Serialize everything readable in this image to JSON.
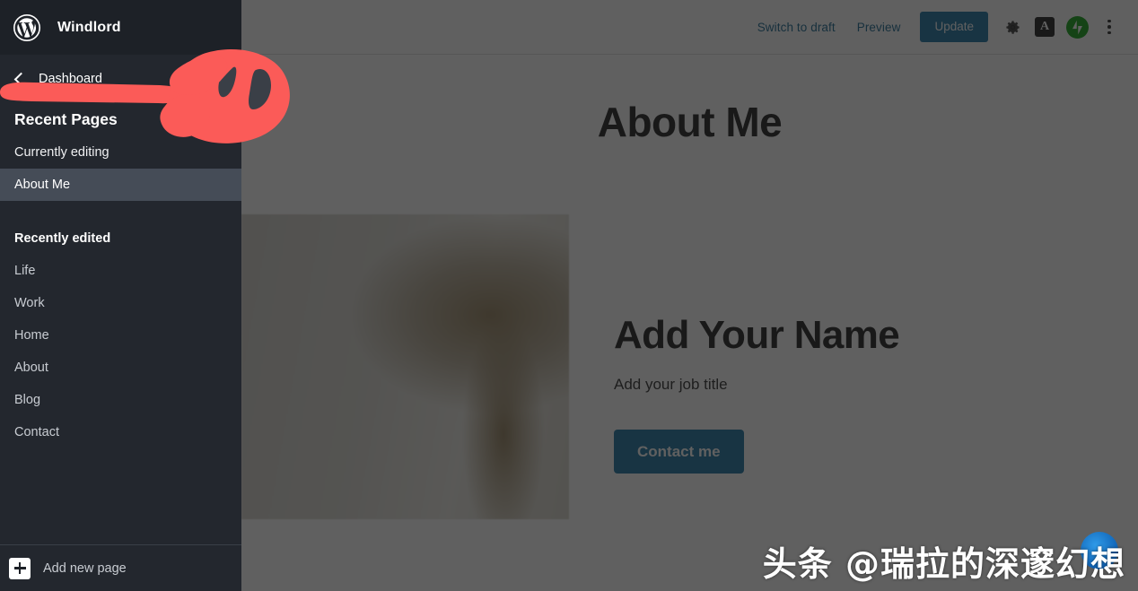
{
  "window": {
    "site_name": "Windlord"
  },
  "toolbar": {
    "list_view_icon": "list-view-icon",
    "switch_to_draft": "Switch to draft",
    "preview": "Preview",
    "update": "Update",
    "settings_icon": "gear-icon",
    "a_badge": "A",
    "jetpack_icon": "jetpack-icon",
    "more_menu_icon": "kebab-menu-icon",
    "link_color": "#0b5e8a",
    "update_bg": "#0f6d9e"
  },
  "sidebar": {
    "logo_icon": "wordpress-logo-icon",
    "back_icon": "chevron-left-icon",
    "back_label": "Dashboard",
    "section_title": "Recent Pages",
    "currently_editing_label": "Currently editing",
    "current_page": "About Me",
    "recently_edited_label": "Recently edited",
    "recent_items": [
      {
        "label": "Life"
      },
      {
        "label": "Work"
      },
      {
        "label": "Home"
      },
      {
        "label": "About"
      },
      {
        "label": "Blog"
      },
      {
        "label": "Contact"
      }
    ],
    "add_new_icon": "plus-icon",
    "add_new_label": "Add new page",
    "bg_color": "#23272e",
    "active_bg_color": "#454c57"
  },
  "canvas": {
    "page_title": "About Me",
    "hero_image_alt": "blurred-landscape-photo",
    "hero_name": "Add Your Name",
    "hero_job_title": "Add your job title",
    "contact_button": "Contact me"
  },
  "annotation": {
    "shape": "red-hand-drawn-arrow",
    "color": "#fb5b58"
  },
  "watermark": {
    "text": "头条 @瑞拉的深邃幻想",
    "badge_icon": "blue-circle-icon"
  }
}
